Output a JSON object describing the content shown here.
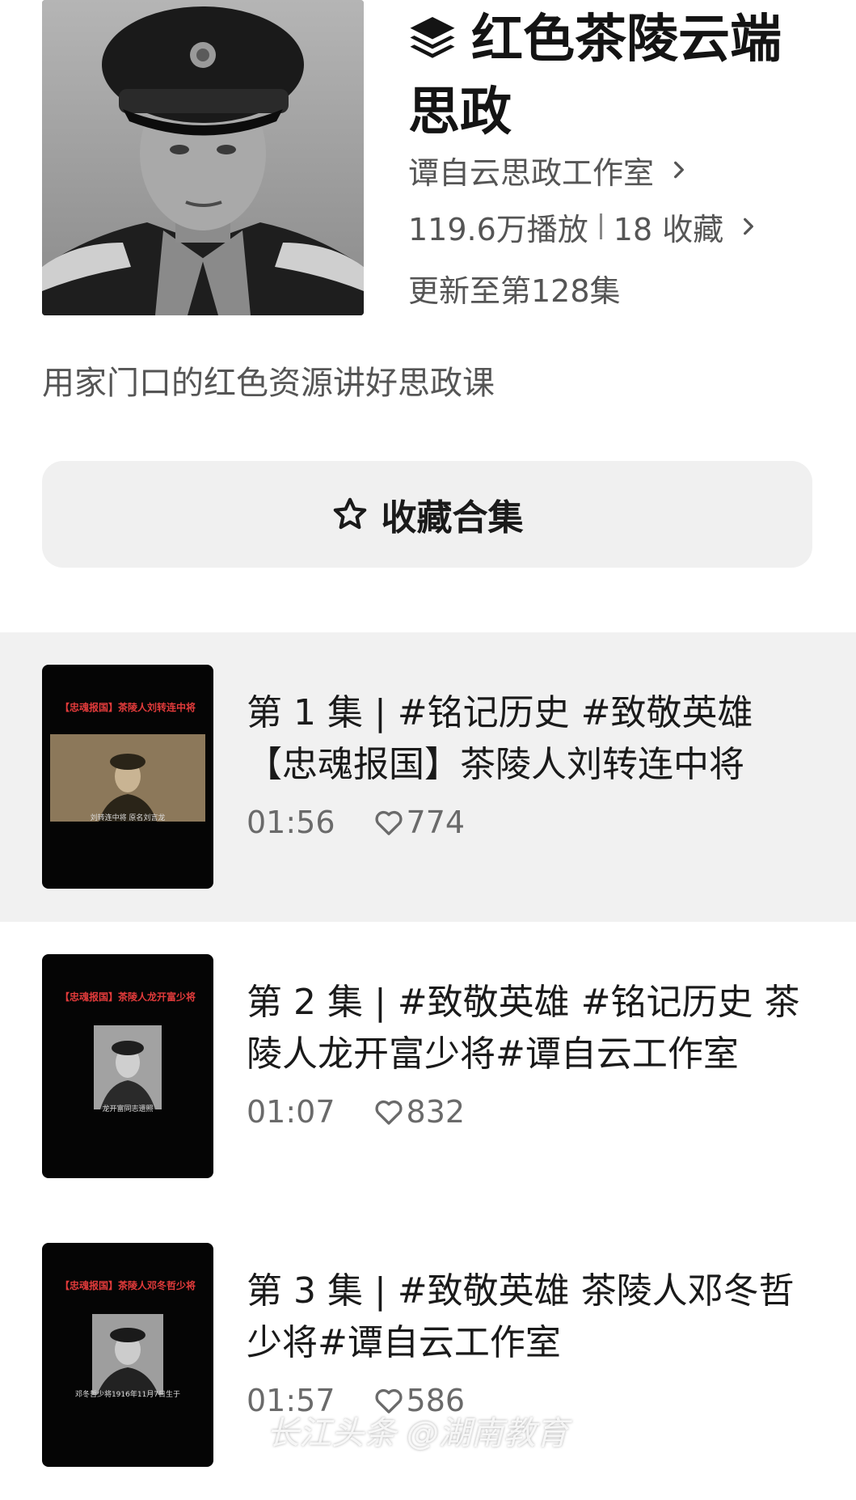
{
  "collection": {
    "title": "红色茶陵云端思政",
    "author": "谭自云思政工作室",
    "plays": "119.6万播放",
    "favorites": "18 收藏",
    "update_status": "更新至第128集",
    "description": "用家门口的红色资源讲好思政课",
    "collect_button_label": "收藏合集"
  },
  "episodes": [
    {
      "title": "第 1 集 | #铭记历史 #致敬英雄【忠魂报国】茶陵人刘转连中将",
      "duration": "01:56",
      "likes": "774",
      "thumb_banner": "【忠魂报国】茶陵人刘转连中将",
      "thumb_caption": "刘转连中将 原名刘言龙"
    },
    {
      "title": "第 2 集 | #致敬英雄 #铭记历史 茶陵人龙开富少将#谭自云工作室",
      "duration": "01:07",
      "likes": "832",
      "thumb_banner": "【忠魂报国】茶陵人龙开富少将",
      "thumb_caption": "龙开富同志遗照"
    },
    {
      "title": "第 3 集 | #致敬英雄 茶陵人邓冬哲少将#谭自云工作室",
      "duration": "01:57",
      "likes": "586",
      "thumb_banner": "【忠魂报国】茶陵人邓冬哲少将",
      "thumb_caption": "邓冬哲少将1916年11月7日生于"
    }
  ],
  "watermark": "长江头条 @湖南教育",
  "icons": {
    "title": "stack-icon",
    "chevron": "chevron-right-icon",
    "collect": "star-icon",
    "like": "heart-icon"
  },
  "colors": {
    "active_row_bg": "#f1f1f1",
    "button_bg": "#f0f0f0",
    "banner_red": "#e23b3b"
  }
}
